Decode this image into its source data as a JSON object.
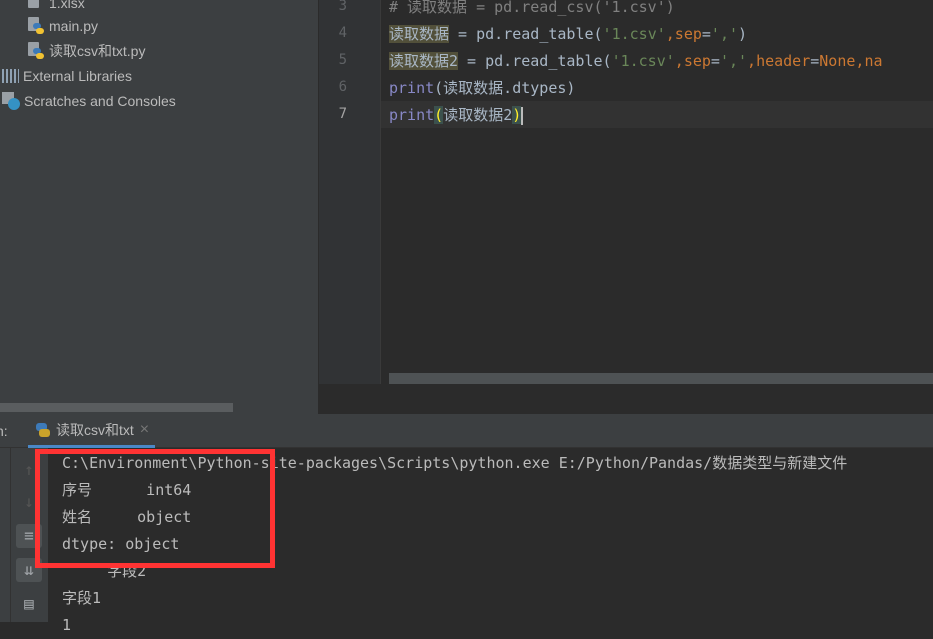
{
  "project_tree": {
    "items": [
      {
        "label": "1.xlsx",
        "icon": "unknown-file-icon"
      },
      {
        "label": "main.py",
        "icon": "python-file-icon"
      },
      {
        "label": "读取csv和txt.py",
        "icon": "python-file-icon"
      },
      {
        "label": "External Libraries",
        "icon": "library-icon"
      },
      {
        "label": "Scratches and Consoles",
        "icon": "scratches-icon"
      }
    ]
  },
  "editor": {
    "line_numbers": [
      "3",
      "4",
      "5",
      "6",
      "7"
    ],
    "lines": [
      {
        "parts": [
          "# 读取数据 = pd.read_csv('1.csv')"
        ]
      },
      {
        "parts": [
          "读取数据",
          " = pd.read_table(",
          "'1.csv'",
          ",",
          "sep",
          "=",
          "','",
          ")"
        ]
      },
      {
        "parts": [
          "读取数据2",
          " = pd.read_table(",
          "'1.csv'",
          ",",
          "sep",
          "=",
          "','",
          ",",
          "header",
          "=",
          "None",
          ",",
          "na"
        ]
      },
      {
        "parts": [
          "print",
          "(读取数据.dtypes)"
        ]
      },
      {
        "parts": [
          "print",
          "(",
          "读取数据2",
          ")"
        ]
      }
    ]
  },
  "run_panel": {
    "label": "n:",
    "tab": "读取csv和txt",
    "close": "×"
  },
  "console": {
    "lines": [
      "C:\\Environment\\Python-site-packages\\Scripts\\python.exe E:/Python/Pandas/数据类型与新建文件",
      "序号      int64",
      "姓名     object",
      "dtype: object",
      "     字段2",
      "字段1",
      "1"
    ]
  },
  "colors": {
    "highlight_box": "#ff3333",
    "accent": "#4a88c7"
  }
}
